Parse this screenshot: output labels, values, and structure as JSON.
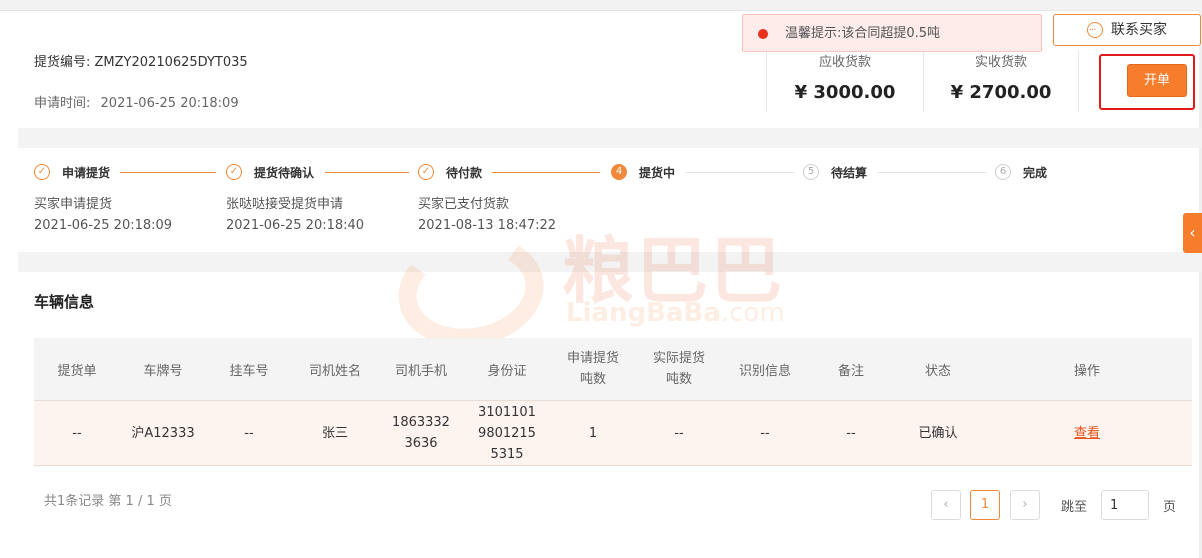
{
  "order": {
    "code_label": "提货编号:",
    "code_value": "ZMZY20210625DYT035",
    "time_label": "申请时间:",
    "time_value": "2021-06-25 20:18:09"
  },
  "amounts": {
    "receivable_label": "应收货款",
    "receivable_value": "¥ 3000.00",
    "received_label": "实收货款",
    "received_value": "¥ 2700.00"
  },
  "alert": {
    "text": "温馨提示:该合同超提0.5吨",
    "icon": "alert-icon",
    "color": "#e8301c"
  },
  "contact_button": {
    "label": "联系买家",
    "icon": "chat-icon"
  },
  "open_button": {
    "label": "开单"
  },
  "steps": [
    {
      "index": "✓",
      "label": "申请提货",
      "status": "done",
      "desc": "买家申请提货",
      "time": "2021-06-25 20:18:09"
    },
    {
      "index": "✓",
      "label": "提货待确认",
      "status": "done",
      "desc": "张哒哒接受提货申请",
      "time": "2021-06-25 20:18:40"
    },
    {
      "index": "✓",
      "label": "待付款",
      "status": "done",
      "desc": "买家已支付货款",
      "time": "2021-08-13 18:47:22"
    },
    {
      "index": "4",
      "label": "提货中",
      "status": "active",
      "desc": "",
      "time": ""
    },
    {
      "index": "5",
      "label": "待结算",
      "status": "todo",
      "desc": "",
      "time": ""
    },
    {
      "index": "6",
      "label": "完成",
      "status": "todo",
      "desc": "",
      "time": ""
    }
  ],
  "watermark": {
    "text": "粮巴巴",
    "sub": "LiangBaBa",
    "sub_suffix": ".com"
  },
  "vehicle": {
    "title": "车辆信息",
    "columns": [
      "提货单",
      "车牌号",
      "挂车号",
      "司机姓名",
      "司机手机",
      "身份证",
      "申请提货吨数",
      "实际提货吨数",
      "识别信息",
      "备注",
      "状态",
      "操作"
    ],
    "rows": [
      {
        "bill": "--",
        "plate": "沪A12333",
        "trailer": "--",
        "driver": "张三",
        "phone": "18633323636",
        "id_card": "310110198012155315",
        "apply_tons": "1",
        "actual_tons": "--",
        "recognition": "--",
        "remark": "--",
        "status": "已确认",
        "action": "查看"
      }
    ]
  },
  "pagination": {
    "summary": "共1条记录 第 1 / 1 页",
    "current": "1",
    "jump_label": "跳至",
    "jump_value": "1",
    "page_suffix": "页"
  },
  "side_tab": {
    "icon": "chevron-left-icon"
  },
  "colors": {
    "accent": "#f57d2c",
    "success": "#2ca01c",
    "danger": "#e3191c"
  }
}
